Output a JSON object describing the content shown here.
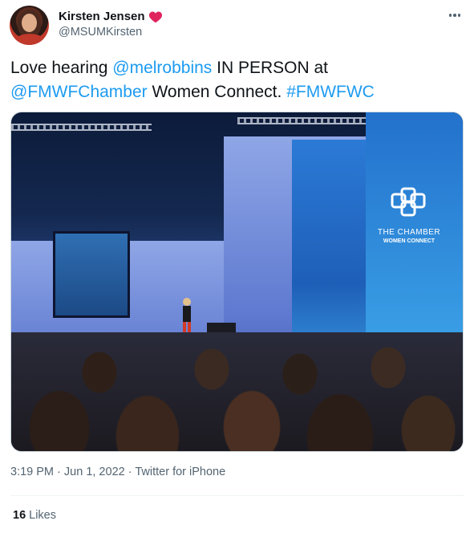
{
  "user": {
    "display_name": "Kirsten Jensen",
    "handle": "@MSUMKirsten",
    "badge_icon": "heart-icon",
    "badge_color": "#e0245e"
  },
  "tweet": {
    "text_parts": {
      "t1": "Love hearing ",
      "mention1": "@melrobbins",
      "t2": " IN PERSON at ",
      "mention2": "@FMWFChamber",
      "t3": " Women Connect. ",
      "hashtag": "#FMWFWC"
    },
    "link_color": "#1d9bf0"
  },
  "media": {
    "logo_title": "THE CHAMBER",
    "logo_subtitle": "WOMEN CONNECT"
  },
  "meta": {
    "time": "3:19 PM",
    "date": "Jun 1, 2022",
    "source": "Twitter for iPhone",
    "separator": "·"
  },
  "stats": {
    "likes_count": "16",
    "likes_label": "Likes"
  }
}
